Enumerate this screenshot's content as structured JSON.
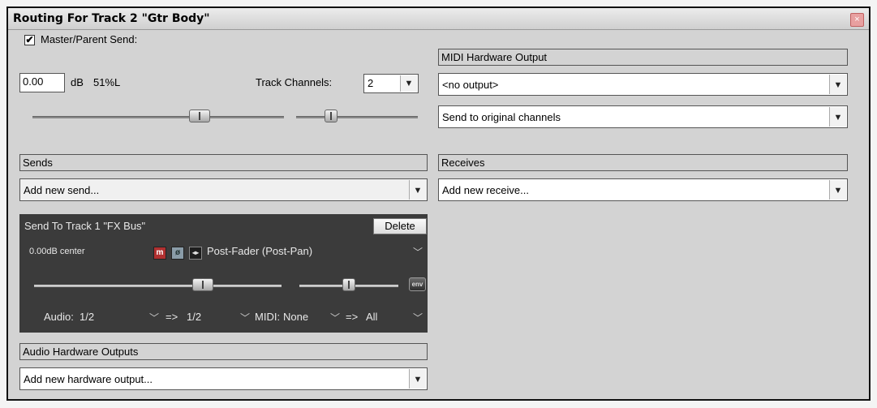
{
  "window": {
    "title": "Routing For Track 2 \"Gtr Body\"",
    "close_icon": "×"
  },
  "master": {
    "checkbox_mark": "✔",
    "label": "Master/Parent Send:",
    "volume_value": "0.00",
    "volume_unit": "dB",
    "pan_text": "51%L",
    "track_channels_label": "Track Channels:",
    "track_channels_value": "2",
    "volume_level": 0.68,
    "pan_level": 0.26
  },
  "midi_hw": {
    "header": "MIDI Hardware Output",
    "device_value": "<no output>",
    "channel_value": "Send to original channels"
  },
  "sends": {
    "header": "Sends",
    "add_placeholder": "Add new send...",
    "send": {
      "title": "Send To Track 1 \"FX Bus\"",
      "delete_label": "Delete",
      "vol_pan_text": "0.00dB center",
      "mute_icon_text": "m",
      "phase_icon_text": "ø",
      "mono_icon_text": "◂▸",
      "mode_value": "Post-Fader (Post-Pan)",
      "env_label": "env",
      "audio_label": "Audio:",
      "audio_src_value": "1/2",
      "arrow1": "=>",
      "audio_dst_value": "1/2",
      "midi_label": "MIDI:",
      "midi_src_value": "None",
      "arrow2": "=>",
      "midi_dst_value": "All",
      "volume_level": 0.7,
      "pan_level": 0.5
    }
  },
  "receives": {
    "header": "Receives",
    "add_placeholder": "Add new receive..."
  },
  "audio_hw": {
    "header": "Audio Hardware Outputs",
    "add_placeholder": "Add new hardware output..."
  },
  "colors": {
    "panel": "#d3d3d3",
    "send_panel": "#3b3b3b",
    "mute_red": "#b03030",
    "close_red": "#e8a0a0"
  }
}
